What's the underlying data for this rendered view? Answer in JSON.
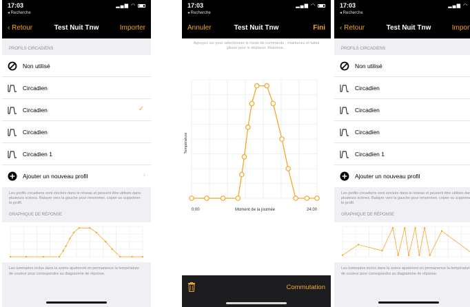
{
  "status": {
    "time": "17:03",
    "back_app": "◂ Recherche"
  },
  "screen1": {
    "nav": {
      "back": "Retour",
      "title": "Test Nuit Tnw",
      "action": "Importer"
    },
    "section_profiles": "PROFILS CIRCADIENS",
    "rows": [
      {
        "label": "Non utilisé",
        "icon": "not-used-icon",
        "checked": false
      },
      {
        "label": "Circadien",
        "icon": "circadian-curve-icon",
        "checked": false
      },
      {
        "label": "Circadien",
        "icon": "circadian-curve-icon",
        "checked": true
      },
      {
        "label": "Circadien",
        "icon": "circadian-curve-icon",
        "checked": false
      },
      {
        "label": "Circadien 1",
        "icon": "circadian-curve-icon",
        "checked": false
      },
      {
        "label": "Ajouter un nouveau profil",
        "icon": "add-icon",
        "checked": false,
        "chevron": true
      }
    ],
    "profiles_note": "Les profils circadiens sont stockés dans le réseau et peuvent être utilisés dans plusieurs scènes. Balayer vers la gauche pour renommer, copier ou supprimer le profil.",
    "section_graph": "GRAPHIQUE DE RÉPONSE",
    "graph_points": [
      [
        0,
        0
      ],
      [
        0.12,
        0
      ],
      [
        0.25,
        0
      ],
      [
        0.37,
        0
      ],
      [
        0.4,
        0.2
      ],
      [
        0.42,
        0.35
      ],
      [
        0.45,
        0.6
      ],
      [
        0.48,
        0.8
      ],
      [
        0.52,
        0.95
      ],
      [
        0.6,
        0.95
      ],
      [
        0.65,
        0.8
      ],
      [
        0.72,
        0.5
      ],
      [
        0.77,
        0.25
      ],
      [
        0.83,
        0
      ],
      [
        0.92,
        0
      ],
      [
        1,
        0
      ]
    ],
    "graph_note": "Les luminaires inclus dans la scène ajusteront en permanence la température de couleur pour correspondre au diagramme de réponse."
  },
  "screen2": {
    "nav": {
      "cancel": "Annuler",
      "title": "Test Nuit Tnw",
      "done": "Fini"
    },
    "hint": "Appuyez sur pour sélectionner le mode de commande - maintenez et faites glisser pour le déplacer. Maintene...",
    "chart_data": {
      "type": "line",
      "ylabel": "Température",
      "xlabel": "Moment de la journée",
      "x_tick_labels": [
        "0:00",
        "24:00"
      ],
      "x": [
        0,
        0.12,
        0.25,
        0.37,
        0.4,
        0.42,
        0.45,
        0.48,
        0.52,
        0.6,
        0.65,
        0.72,
        0.77,
        0.83,
        0.92,
        1
      ],
      "values": [
        0,
        0,
        0,
        0,
        0.2,
        0.35,
        0.6,
        0.8,
        0.95,
        0.95,
        0.8,
        0.5,
        0.25,
        0,
        0,
        0
      ],
      "grid": true,
      "color": "#f5a623"
    },
    "toolbar_action": "Commutation"
  },
  "screen3": {
    "nav": {
      "back": "Retour",
      "title": "Test Nuit Tnw",
      "action": "Importer"
    },
    "section_profiles": "PROFILS CIRCADIENS",
    "rows": [
      {
        "label": "Non utilisé",
        "icon": "not-used-icon",
        "checked": false
      },
      {
        "label": "Circadien",
        "icon": "circadian-curve-icon",
        "checked": true
      },
      {
        "label": "Circadien",
        "icon": "circadian-curve-icon",
        "checked": false
      },
      {
        "label": "Circadien",
        "icon": "circadian-curve-icon",
        "checked": false
      },
      {
        "label": "Circadien 1",
        "icon": "circadian-curve-icon",
        "checked": false
      },
      {
        "label": "Ajouter un nouveau profil",
        "icon": "add-icon",
        "checked": false,
        "chevron": true
      }
    ],
    "profiles_note": "Les profils circadiens sont stockés dans le réseau et peuvent être utilisés dans plusieurs scènes. Balayer vers la gauche pour renommer, copier ou supprimer le profil.",
    "section_graph": "GRAPHIQUE DE RÉPONSE",
    "graph_points": [
      [
        0,
        0.05
      ],
      [
        0.12,
        0.4
      ],
      [
        0.3,
        0.2
      ],
      [
        0.38,
        0.95
      ],
      [
        0.42,
        0.05
      ],
      [
        0.47,
        0.95
      ],
      [
        0.5,
        0.05
      ],
      [
        0.55,
        0.95
      ],
      [
        0.58,
        0.05
      ],
      [
        0.62,
        0.95
      ],
      [
        0.66,
        0.05
      ],
      [
        0.75,
        0.85
      ],
      [
        1,
        0.05
      ]
    ],
    "graph_note": "Les luminaires inclus dans la scène ajusteront en permanence la température de couleur pour correspondre au diagramme de réponse."
  },
  "colors": {
    "accent": "#f5a623",
    "bar": "#000000",
    "background": "#efeff4"
  }
}
